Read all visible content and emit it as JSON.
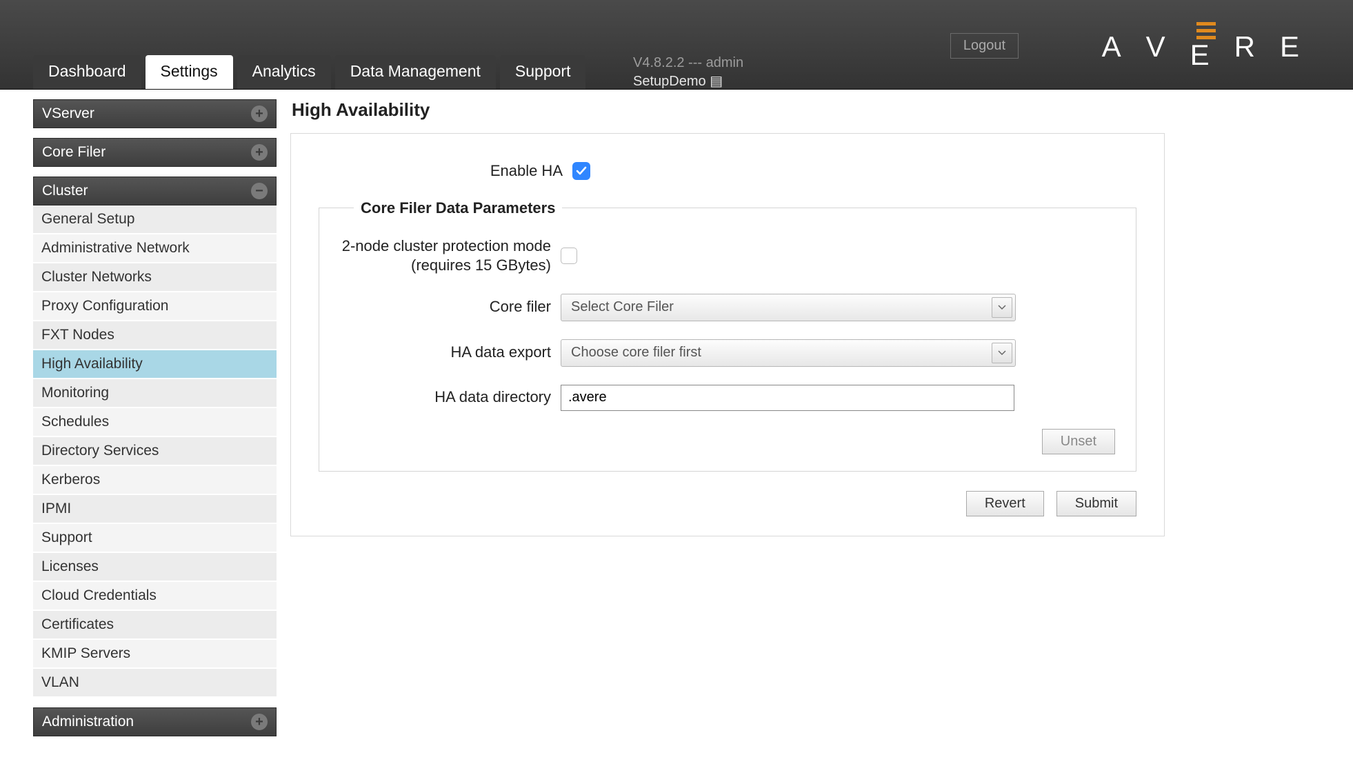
{
  "header": {
    "logout_label": "Logout",
    "version_line": "V4.8.2.2 --- admin",
    "setup_name": "SetupDemo",
    "logo_letters": [
      "A",
      "V",
      "E",
      "R",
      "E"
    ]
  },
  "tabs": [
    {
      "label": "Dashboard",
      "active": false
    },
    {
      "label": "Settings",
      "active": true
    },
    {
      "label": "Analytics",
      "active": false
    },
    {
      "label": "Data Management",
      "active": false
    },
    {
      "label": "Support",
      "active": false
    }
  ],
  "sidebar": {
    "sections": [
      {
        "title": "VServer",
        "icon": "plus",
        "open": false
      },
      {
        "title": "Core Filer",
        "icon": "plus",
        "open": false
      },
      {
        "title": "Cluster",
        "icon": "minus",
        "open": true
      },
      {
        "title": "Administration",
        "icon": "plus",
        "open": false
      }
    ],
    "cluster_items": [
      {
        "label": "General Setup",
        "selected": false
      },
      {
        "label": "Administrative Network",
        "selected": false
      },
      {
        "label": "Cluster Networks",
        "selected": false
      },
      {
        "label": "Proxy Configuration",
        "selected": false
      },
      {
        "label": "FXT Nodes",
        "selected": false
      },
      {
        "label": "High Availability",
        "selected": true
      },
      {
        "label": "Monitoring",
        "selected": false
      },
      {
        "label": "Schedules",
        "selected": false
      },
      {
        "label": "Directory Services",
        "selected": false
      },
      {
        "label": "Kerberos",
        "selected": false
      },
      {
        "label": "IPMI",
        "selected": false
      },
      {
        "label": "Support",
        "selected": false
      },
      {
        "label": "Licenses",
        "selected": false
      },
      {
        "label": "Cloud Credentials",
        "selected": false
      },
      {
        "label": "Certificates",
        "selected": false
      },
      {
        "label": "KMIP Servers",
        "selected": false
      },
      {
        "label": "VLAN",
        "selected": false
      }
    ]
  },
  "main": {
    "page_title": "High Availability",
    "enable_ha_label": "Enable HA",
    "enable_ha_checked": true,
    "fieldset_legend": "Core Filer Data Parameters",
    "two_node_label": "2-node cluster protection mode (requires 15 GBytes)",
    "two_node_checked": false,
    "core_filer_label": "Core filer",
    "core_filer_value": "Select Core Filer",
    "ha_export_label": "HA data export",
    "ha_export_value": "Choose core filer first",
    "ha_dir_label": "HA data directory",
    "ha_dir_value": ".avere",
    "unset_label": "Unset",
    "revert_label": "Revert",
    "submit_label": "Submit"
  }
}
